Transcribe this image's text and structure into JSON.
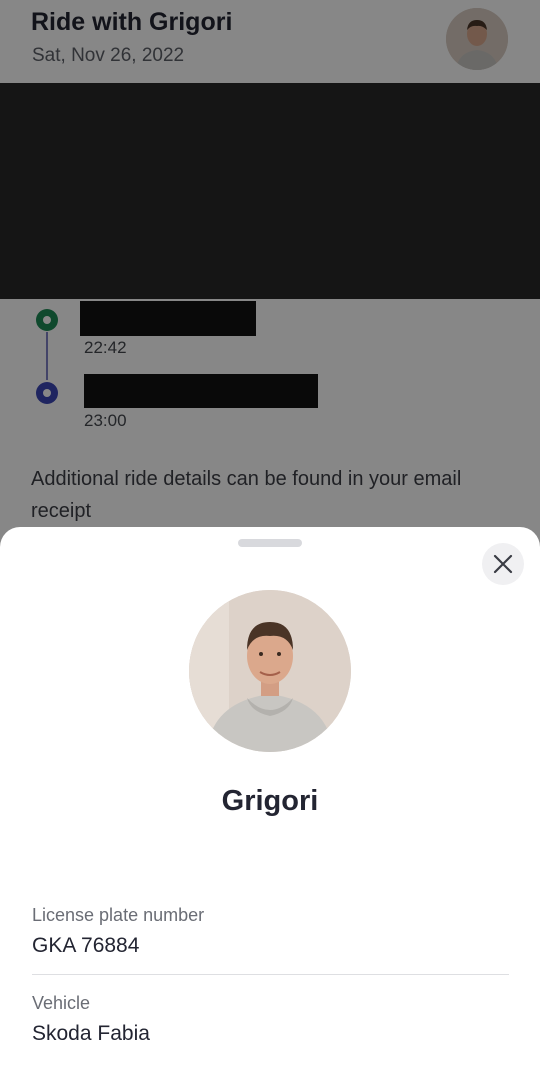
{
  "header": {
    "title": "Ride with Grigori",
    "date": "Sat, Nov 26, 2022"
  },
  "route": {
    "stops": [
      {
        "time": "22:42"
      },
      {
        "time": "23:00"
      }
    ]
  },
  "note": "Additional ride details can be found in your email receipt",
  "driver_sheet": {
    "name": "Grigori",
    "fields": [
      {
        "label": "License plate number",
        "value": "GKA 76884"
      },
      {
        "label": "Vehicle",
        "value": "Skoda Fabia"
      }
    ]
  },
  "icons": {
    "close": "close-icon",
    "start_marker": "pickup-marker-icon",
    "end_marker": "dropoff-marker-icon"
  },
  "colors": {
    "pickup": "#1e8a55",
    "dropoff": "#3b47b5",
    "route_line": "#7f81c5",
    "text_primary": "#232532"
  }
}
